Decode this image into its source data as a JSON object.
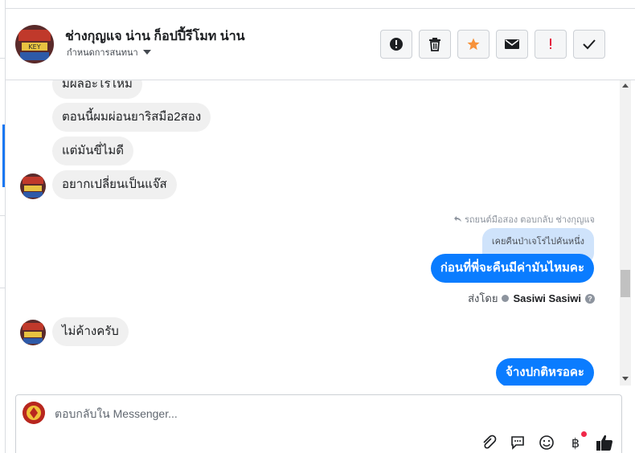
{
  "header": {
    "title": "ช่างกุญแจ น่าน ก็อปปี้รีโมท น่าน",
    "subtitle": "กำหนดการสนทนา"
  },
  "actions": [
    {
      "name": "report-icon-button",
      "icon": "exclamation-circle-icon"
    },
    {
      "name": "delete-button",
      "icon": "trash-icon"
    },
    {
      "name": "star-button",
      "icon": "star-icon",
      "color": "#f7923a"
    },
    {
      "name": "mark-unread-button",
      "icon": "envelope-icon"
    },
    {
      "name": "spam-button",
      "icon": "exclamation-icon",
      "color": "#e41e3f"
    },
    {
      "name": "done-button",
      "icon": "check-icon"
    }
  ],
  "messages": {
    "m1": "มีผลอะไรไหม",
    "m2": "ตอนนี้ผมผ่อนยาริสมือ2สอง",
    "m3": "แต่มันขี่ไมดี",
    "m4": "อยากเปลี่ยนเป็นแจ๊ส",
    "reply_meta": "รถยนต์มือสอง ตอบกลับ ช่างกุญแจ",
    "quoted": "เคยคืนป่าเจโร่ไปคันหนึ่ง",
    "m5": "ก่อนที่พี่จะคืนมีค่ามันไหมคะ",
    "sent_by_label": "ส่งโดย",
    "sent_by_name": "Sasiwi Sasiwi",
    "m6": "ไม่ค้างครับ",
    "m7": "จ้างปกติหรอคะ"
  },
  "composer": {
    "placeholder": "ตอบกลับใน Messenger..."
  },
  "tools": [
    "attachment-icon",
    "comment-icon",
    "emoji-icon",
    "baht-payment-icon",
    "thumbs-up-icon"
  ],
  "colors": {
    "accent": "#0a7cff",
    "incoming_bubble": "#f0f0f0",
    "quoted_bubble": "#cfe3fb"
  }
}
